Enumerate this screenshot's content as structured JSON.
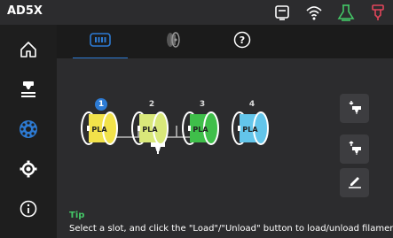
{
  "header": {
    "device_name": "AD5X",
    "status_icons": [
      "camera-icon",
      "wifi-icon",
      "flask-icon",
      "filament-heater-icon"
    ]
  },
  "sidebar": {
    "items": [
      {
        "name": "home",
        "icon": "home-icon",
        "active": false
      },
      {
        "name": "print",
        "icon": "print-nozzle-icon",
        "active": false
      },
      {
        "name": "filament",
        "icon": "filament-spool-icon",
        "active": true
      },
      {
        "name": "settings",
        "icon": "gear-icon",
        "active": false
      },
      {
        "name": "about",
        "icon": "info-icon",
        "active": false
      }
    ]
  },
  "tabs": [
    {
      "name": "slots",
      "icon": "filament-slots-icon",
      "active": true
    },
    {
      "name": "spool",
      "icon": "spool-side-icon",
      "active": false
    },
    {
      "name": "help",
      "icon": "question-icon",
      "active": false
    }
  ],
  "slots": [
    {
      "number": "1",
      "label": "PLA",
      "color": "#f2e24a",
      "selected": true
    },
    {
      "number": "2",
      "label": "PLA",
      "color": "#d9e87a",
      "selected": false
    },
    {
      "number": "3",
      "label": "PLA",
      "color": "#3fbf4a",
      "selected": false
    },
    {
      "number": "4",
      "label": "PLA",
      "color": "#63c5ea",
      "selected": false
    }
  ],
  "actions": [
    {
      "name": "load",
      "icon": "load-filament-icon"
    },
    {
      "name": "unload",
      "icon": "unload-filament-icon"
    },
    {
      "name": "edit",
      "icon": "edit-pencil-icon"
    }
  ],
  "tip": {
    "title": "Tip",
    "text": "Select a slot, and click the \"Load\"/\"Unload\" button to load/unload filament."
  },
  "colors": {
    "accent": "#2d7bd4",
    "tip_green": "#44c767",
    "topbar": "#2c2c2e",
    "panel": "#2c2c2e"
  }
}
